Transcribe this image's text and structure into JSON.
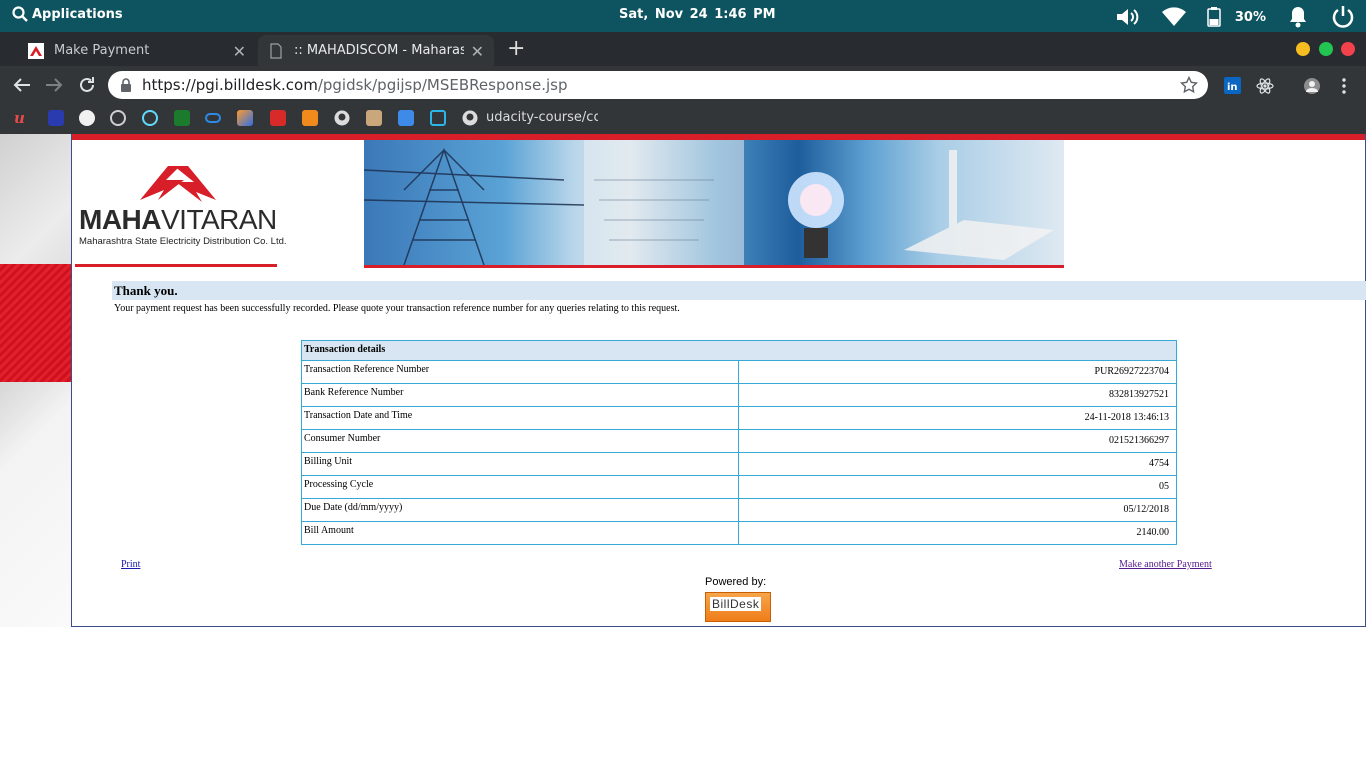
{
  "system_bar": {
    "applications_label": "Applications",
    "date_time": "Sat, Nov 24   1:46 PM",
    "battery_percent": "30%"
  },
  "browser": {
    "tabs": [
      {
        "title": "Make Payment",
        "active": false
      },
      {
        "title": ":: MAHADISCOM - Maharashtra",
        "active": true
      }
    ],
    "url_host": "https://pgi.billdesk.com",
    "url_path": "/pgidsk/pgijsp/MSEBResponse.jsp",
    "bookmark_label": "udacity-course/cour"
  },
  "header": {
    "logo_word_bold": "MAHA",
    "logo_word_light": "VITARAN",
    "logo_subtitle": "Maharashtra State Electricity Distribution Co. Ltd."
  },
  "message": {
    "heading": "Thank you.",
    "body": "Your payment request has been successfully recorded. Please quote your transaction reference number for any queries relating to this request."
  },
  "transaction": {
    "title": "Transaction details",
    "rows": [
      {
        "label": "Transaction Reference Number",
        "value": "PUR26927223704"
      },
      {
        "label": "Bank Reference Number",
        "value": "832813927521"
      },
      {
        "label": "Transaction Date and Time",
        "value": "24-11-2018 13:46:13"
      },
      {
        "label": "Consumer Number",
        "value": "021521366297"
      },
      {
        "label": "Billing Unit",
        "value": "4754"
      },
      {
        "label": "Processing Cycle",
        "value": "05"
      },
      {
        "label": "Due Date (dd/mm/yyyy)",
        "value": "05/12/2018"
      },
      {
        "label": "Bill Amount",
        "value": "2140.00"
      }
    ]
  },
  "footer": {
    "print_label": "Print",
    "another_payment_label": "Make another Payment",
    "powered_by": "Powered by:",
    "billdesk_logo_text": "BillDesk"
  },
  "colors": {
    "system_bar": "#0e5460",
    "accent_red": "#d81e28",
    "table_border": "#36a9d6",
    "header_fill": "#d7e6f2"
  }
}
